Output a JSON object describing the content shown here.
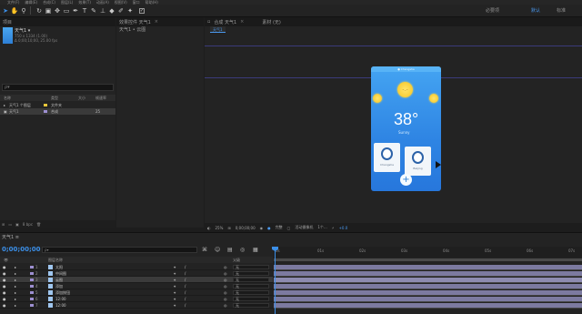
{
  "menubar": {
    "items": [
      "文件(F)",
      "编辑(E)",
      "合成(C)",
      "图层(L)",
      "效果(T)",
      "动画(A)",
      "视图(V)",
      "窗口",
      "帮助(H)"
    ]
  },
  "toolbar": {
    "tools": [
      "selection",
      "hand",
      "zoom",
      "rotate",
      "camera",
      "pan-behind",
      "rectangle",
      "pen",
      "text",
      "brush",
      "clone-stamp",
      "eraser",
      "roto-brush",
      "puppet"
    ],
    "workspaces": [
      "必要项",
      "默认",
      "标准"
    ],
    "active_workspace": "默认"
  },
  "project": {
    "tab": "项目",
    "comp_name": "天气1 ▾",
    "comp_info_1": "750 x 1334 (1.00)",
    "comp_info_2": "Δ 0;00;10;00, 25.00 fps",
    "search_placeholder": "ρ▾",
    "columns": [
      "名称",
      "类型",
      "大小",
      "帧速率"
    ],
    "rows": [
      {
        "name": "天气1 个图层",
        "type": "文件夹",
        "size": "",
        "fps": "",
        "color": "#e7c63a"
      },
      {
        "name": "天气1",
        "type": "合成",
        "size": "",
        "fps": "25",
        "color": "#9d8fd1"
      }
    ],
    "footer_bpc": "8 bpc"
  },
  "effects": {
    "tab": "效果控件 天气1",
    "subtitle": "天气1 • 云图"
  },
  "composition": {
    "tab": "合成 天气1",
    "tab2": "素材 (无)",
    "subtab": "天气1",
    "phone": {
      "status": "● Changsha",
      "temperature": "38°",
      "condition": "Sunny",
      "card1_label": "Changsha",
      "card2_label": "Beijing",
      "add": "+"
    },
    "footer": {
      "zoom": "25%",
      "timecode": "0;00;00;00",
      "resolution": "完整",
      "camera": "活动摄像机",
      "views": "1个...",
      "exposure": "+0.0"
    }
  },
  "timeline": {
    "tab": "天气1 ≡",
    "current_time": "0;00;00;00",
    "search_placeholder": "ρ▾",
    "layer_columns": [
      "图层名称",
      "父级"
    ],
    "layers": [
      {
        "num": "1",
        "name": "太阳",
        "parent": "无",
        "color": "#9d8fd1"
      },
      {
        "num": "2",
        "name": "中间图",
        "parent": "无",
        "color": "#9d8fd1"
      },
      {
        "num": "3",
        "name": "云图",
        "parent": "无",
        "color": "#9d8fd1",
        "selected": true
      },
      {
        "num": "4",
        "name": "添加",
        "parent": "无",
        "color": "#9d8fd1"
      },
      {
        "num": "5",
        "name": "添加按钮",
        "parent": "无",
        "color": "#9d8fd1"
      },
      {
        "num": "6",
        "name": "12:00",
        "parent": "无",
        "color": "#9d8fd1"
      },
      {
        "num": "7",
        "name": "12:00",
        "parent": "无",
        "color": "#9d8fd1"
      }
    ],
    "ruler_labels": [
      "0s",
      "01s",
      "02s",
      "03s",
      "04s",
      "05s",
      "06s",
      "07s"
    ]
  },
  "colors": {
    "accent": "#3b8fe8",
    "phone_bg": "#3b93ea",
    "sun": "#f5c421"
  }
}
